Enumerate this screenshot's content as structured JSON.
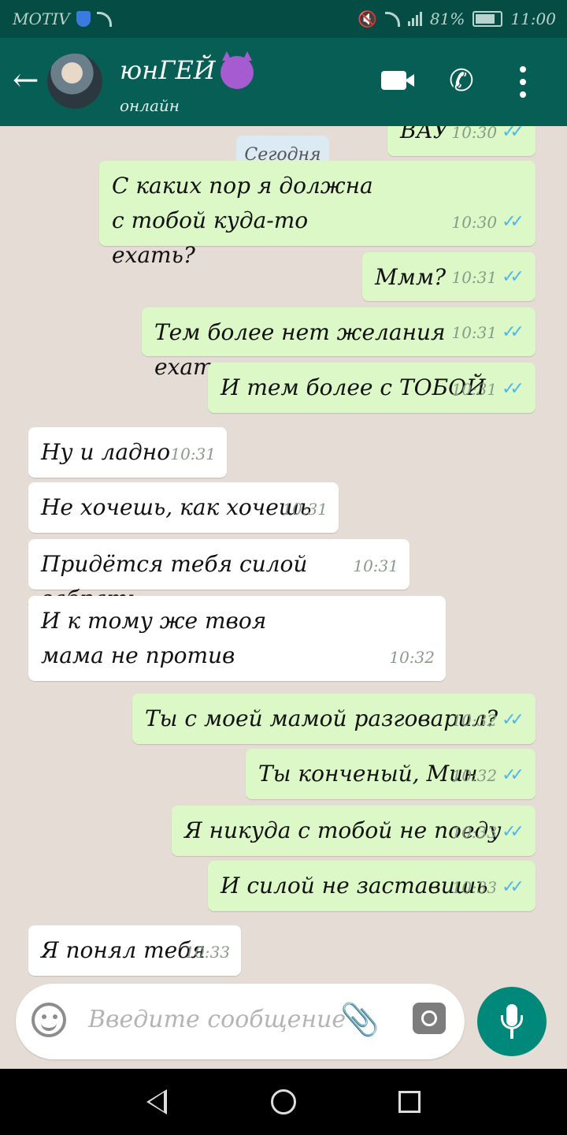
{
  "status_bar": {
    "carrier": "MOTIV",
    "battery": "81%",
    "time": "11:00"
  },
  "header": {
    "contact_name": "юнГЕЙ",
    "status": "онлайн"
  },
  "date_label": "Сегодня",
  "messages": [
    {
      "dir": "out",
      "text": "ВАУ",
      "time": "10:30"
    },
    {
      "dir": "out",
      "text": "С каких пор я должна с тобой куда-то ехать?",
      "time": "10:30"
    },
    {
      "dir": "out",
      "text": "Ммм?",
      "time": "10:31"
    },
    {
      "dir": "out",
      "text": "Тем более нет желания ехать",
      "time": "10:31"
    },
    {
      "dir": "out",
      "text": "И тем более с ТОБОЙ",
      "time": "10:31"
    },
    {
      "dir": "in",
      "text": "Ну и ладно",
      "time": "10:31"
    },
    {
      "dir": "in",
      "text": "Не хочешь, как хочешь",
      "time": "10:31"
    },
    {
      "dir": "in",
      "text": "Придётся тебя силой забрать",
      "time": "10:31"
    },
    {
      "dir": "in",
      "text": "И к тому же твоя мама не против",
      "time": "10:32"
    },
    {
      "dir": "out",
      "text": "Ты с моей мамой разговарил?",
      "time": "10:32"
    },
    {
      "dir": "out",
      "text": "Ты конченый, Мин",
      "time": "10:32"
    },
    {
      "dir": "out",
      "text": "Я никуда с тобой не поеду",
      "time": "10:33"
    },
    {
      "dir": "out",
      "text": "И силой не заставишь",
      "time": "10:33"
    },
    {
      "dir": "in",
      "text": "Я понял тебя",
      "time": "10:33"
    }
  ],
  "composer": {
    "placeholder": "Введите сообщение"
  },
  "colors": {
    "header": "#075e54",
    "outgoing_bubble": "#dcf8c6",
    "incoming_bubble": "#ffffff",
    "tick": "#4fb6ec",
    "mic": "#00897b"
  }
}
